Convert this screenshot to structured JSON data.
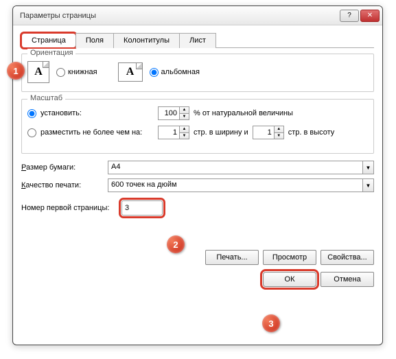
{
  "titlebar": {
    "title": "Параметры страницы"
  },
  "tabs": {
    "page": "Страница",
    "margins": "Поля",
    "headerfooter": "Колонтитулы",
    "sheet": "Лист"
  },
  "orientation": {
    "legend": "Ориентация",
    "portrait": "книжная",
    "landscape": "альбомная",
    "glyphA": "A"
  },
  "scale": {
    "legend": "Масштаб",
    "setLabel": "установить:",
    "setValue": "100",
    "setSuffix": "% от натуральной величины",
    "fitLabel": "разместить не более чем на:",
    "wide": "1",
    "wideSuffix": "стр. в ширину и",
    "tall": "1",
    "tallSuffix": "стр. в высоту"
  },
  "paper": {
    "sizeLabel": "Размер бумаги:",
    "sizeValue": "A4",
    "qualityLabel": "Качество печати:",
    "qualityValue": "600 точек на дюйм"
  },
  "firstPage": {
    "label": "Номер первой страницы:",
    "value": "3"
  },
  "buttons": {
    "print": "Печать...",
    "preview": "Просмотр",
    "options": "Свойства...",
    "ok": "ОК",
    "cancel": "Отмена"
  },
  "callouts": {
    "c1": "1",
    "c2": "2",
    "c3": "3"
  }
}
